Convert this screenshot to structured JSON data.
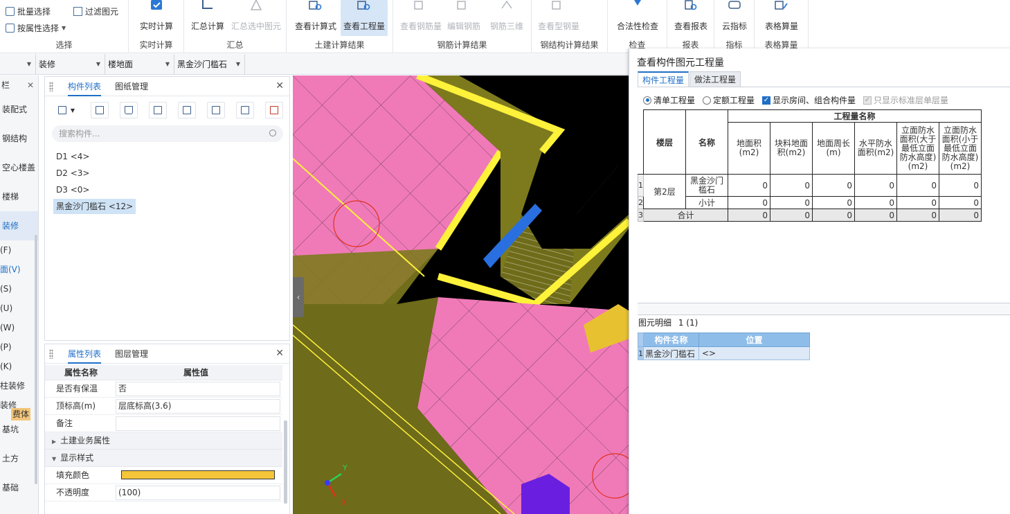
{
  "ribbon": {
    "select_group": {
      "batch_select": "批量选择",
      "filter": "过滤图元",
      "by_attr": "按属性选择",
      "label": "选择"
    },
    "realtime_group": {
      "realtime": "实时计算",
      "label": "实时计算"
    },
    "summary_group": {
      "sum_calc": "汇总计算",
      "sum_selected": "汇总选中图元",
      "label": "汇总"
    },
    "civil_group": {
      "view_formula": "查看计算式",
      "view_quantity": "查看工程量",
      "label": "土建计算结果"
    },
    "rebar_group": {
      "view_rebar": "查看钢筋量",
      "edit_rebar": "编辑钢筋",
      "rebar_3d": "钢筋三维",
      "label": "钢筋计算结果"
    },
    "steel_group": {
      "view_steel": "查看型钢量",
      "label": "钢结构计算结果"
    },
    "check_group": {
      "legality": "合法性检查",
      "label": "检查"
    },
    "report_group": {
      "view_report": "查看报表",
      "label": "报表"
    },
    "index_group": {
      "cloud_index": "云指标",
      "label": "指标"
    },
    "table_group": {
      "table_qty": "表格算量",
      "label": "表格算量"
    }
  },
  "selectors": {
    "first": "",
    "category": "装修",
    "floor_type": "楼地面",
    "component": "黑金沙门槛石"
  },
  "leftnav": {
    "header": "栏",
    "items": [
      "装配式",
      "钢结构",
      "空心楼盖",
      "楼梯",
      "装修"
    ],
    "subitems": [
      "(F)",
      "面(V)",
      "(S)",
      "(U)",
      "(W)",
      "(P)",
      "(K)",
      "柱装修",
      "装修"
    ],
    "bottom_items": [
      "基坑",
      "土方",
      "基础"
    ],
    "badge": "费体"
  },
  "component_panel": {
    "tabs": [
      "构件列表",
      "图纸管理"
    ],
    "search_placeholder": "搜索构件...",
    "items": [
      "D1 <4>",
      "D2 <3>",
      "D3 <0>",
      "黑金沙门槛石 <12>"
    ]
  },
  "property_panel": {
    "tabs": [
      "属性列表",
      "图层管理"
    ],
    "col_name": "属性名称",
    "col_value": "属性值",
    "rows": [
      {
        "name": "是否有保温",
        "value": "否"
      },
      {
        "name": "顶标高(m)",
        "value": "层底标高(3.6)"
      },
      {
        "name": "备注",
        "value": ""
      }
    ],
    "group_civil": "土建业务属性",
    "group_display": "显示样式",
    "fill_color_label": "填充颜色",
    "fill_color": "#f5c53a",
    "opacity_label": "不透明度",
    "opacity_value": "(100)"
  },
  "viewport": {
    "axis_y": "Y",
    "axis_x": "X"
  },
  "dialog": {
    "title": "查看构件图元工程量",
    "tabs": [
      "构件工程量",
      "做法工程量"
    ],
    "options": {
      "list_qty": "清单工程量",
      "quota_qty": "定额工程量",
      "show_rooms": "显示房间、组合构件量",
      "std_floor_only": "只显示标准层单层量"
    },
    "table": {
      "group_header": "工程量名称",
      "col_floor": "楼层",
      "col_name": "名称",
      "cols": [
        "地面积(m2)",
        "块料地面积(m2)",
        "地面周长(m)",
        "水平防水面积(m2)",
        "立面防水面积(大于最低立面防水高度)(m2)",
        "立面防水面积(小于最低立面防水高度)(m2)"
      ],
      "row_numbers": [
        "1",
        "2",
        "3"
      ],
      "floor": "第2层",
      "item_name": "黑金沙门槛石",
      "item_values": [
        "0",
        "0",
        "0",
        "0",
        "0",
        "0"
      ],
      "subtotal_label": "小计",
      "subtotal_values": [
        "0",
        "0",
        "0",
        "0",
        "0",
        "0"
      ],
      "total_label": "合计",
      "total_values": [
        "0",
        "0",
        "0",
        "0",
        "0",
        "0"
      ]
    },
    "detail": {
      "title": "图元明细",
      "count": "1 (1)",
      "col_name": "构件名称",
      "col_pos": "位置",
      "row_number": "1",
      "row_name": "黑金沙门槛石",
      "row_pos": "<>"
    }
  },
  "colors": {
    "accent": "#1f6fc7",
    "floor_tile": "#f07ab8",
    "wall": "#7d7a1e",
    "highlight": "#fff23a"
  }
}
